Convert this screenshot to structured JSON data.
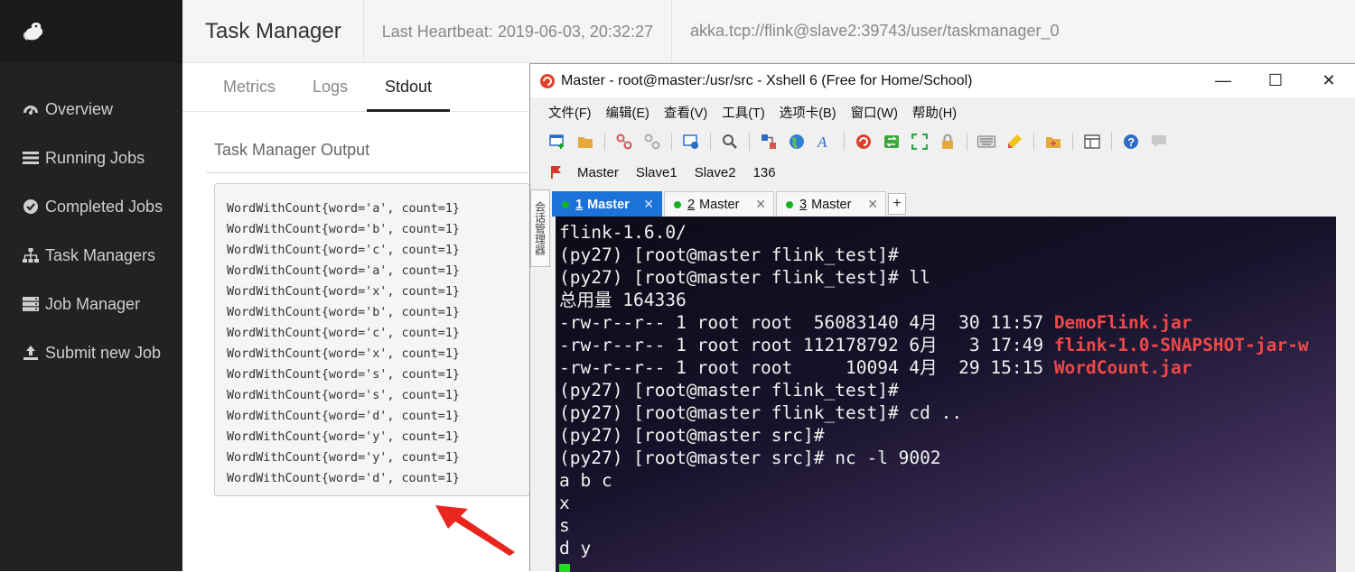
{
  "sidebar": {
    "items": [
      {
        "label": "Overview",
        "icon": "dashboard-icon"
      },
      {
        "label": "Running Jobs",
        "icon": "list-icon"
      },
      {
        "label": "Completed Jobs",
        "icon": "check-circle-icon"
      },
      {
        "label": "Task Managers",
        "icon": "sitemap-icon"
      },
      {
        "label": "Job Manager",
        "icon": "server-icon"
      },
      {
        "label": "Submit new Job",
        "icon": "upload-icon"
      }
    ]
  },
  "header": {
    "title": "Task Manager",
    "heartbeat": "Last Heartbeat: 2019-06-03, 20:32:27",
    "akka": "akka.tcp://flink@slave2:39743/user/taskmanager_0"
  },
  "tabs": [
    "Metrics",
    "Logs",
    "Stdout"
  ],
  "output": {
    "title": "Task Manager Output",
    "lines": [
      "WordWithCount{word='a', count=1}",
      "WordWithCount{word='b', count=1}",
      "WordWithCount{word='c', count=1}",
      "WordWithCount{word='a', count=1}",
      "WordWithCount{word='x', count=1}",
      "WordWithCount{word='b', count=1}",
      "WordWithCount{word='c', count=1}",
      "WordWithCount{word='x', count=1}",
      "WordWithCount{word='s', count=1}",
      "WordWithCount{word='s', count=1}",
      "WordWithCount{word='d', count=1}",
      "WordWithCount{word='y', count=1}",
      "WordWithCount{word='y', count=1}",
      "WordWithCount{word='d', count=1}"
    ]
  },
  "xshell": {
    "title": "Master - root@master:/usr/src - Xshell 6 (Free for Home/School)",
    "window_buttons": {
      "minimize": "—",
      "maximize": "☐",
      "close": "✕"
    },
    "menu": [
      "文件(F)",
      "编辑(E)",
      "查看(V)",
      "工具(T)",
      "选项卡(B)",
      "窗口(W)",
      "帮助(H)"
    ],
    "bookmarks": [
      "Master",
      "Slave1",
      "Slave2",
      "136"
    ],
    "session_panel": "会话管理器",
    "tabs": [
      {
        "num": "1",
        "name": "Master",
        "active": true
      },
      {
        "num": "2",
        "name": "Master",
        "active": false
      },
      {
        "num": "3",
        "name": "Master",
        "active": false
      }
    ],
    "new_tab": "+",
    "terminal": [
      {
        "text": "flink-1.6.0/"
      },
      {
        "text": "(py27) [root@master flink_test]#"
      },
      {
        "text": "(py27) [root@master flink_test]# ll"
      },
      {
        "text": "总用量 164336"
      },
      {
        "text": "-rw-r--r-- 1 root root  56083140 4月  30 11:57 ",
        "file": "DemoFlink.jar"
      },
      {
        "text": "-rw-r--r-- 1 root root 112178792 6月   3 17:49 ",
        "file": "flink-1.0-SNAPSHOT-jar-w"
      },
      {
        "text": "-rw-r--r-- 1 root root     10094 4月  29 15:15 ",
        "file": "WordCount.jar"
      },
      {
        "text": "(py27) [root@master flink_test]#"
      },
      {
        "text": "(py27) [root@master flink_test]# cd .."
      },
      {
        "text": "(py27) [root@master src]#"
      },
      {
        "text": "(py27) [root@master src]# nc -l 9002"
      },
      {
        "text": "a b c"
      },
      {
        "text": "x"
      },
      {
        "text": "s"
      },
      {
        "text": "d y"
      }
    ]
  },
  "colors": {
    "sidebar_bg": "#222222",
    "accent_tab": "#1b73d9",
    "file_red": "#ef4848",
    "cursor_green": "#22dd22",
    "arrow_red": "#e8261e"
  }
}
